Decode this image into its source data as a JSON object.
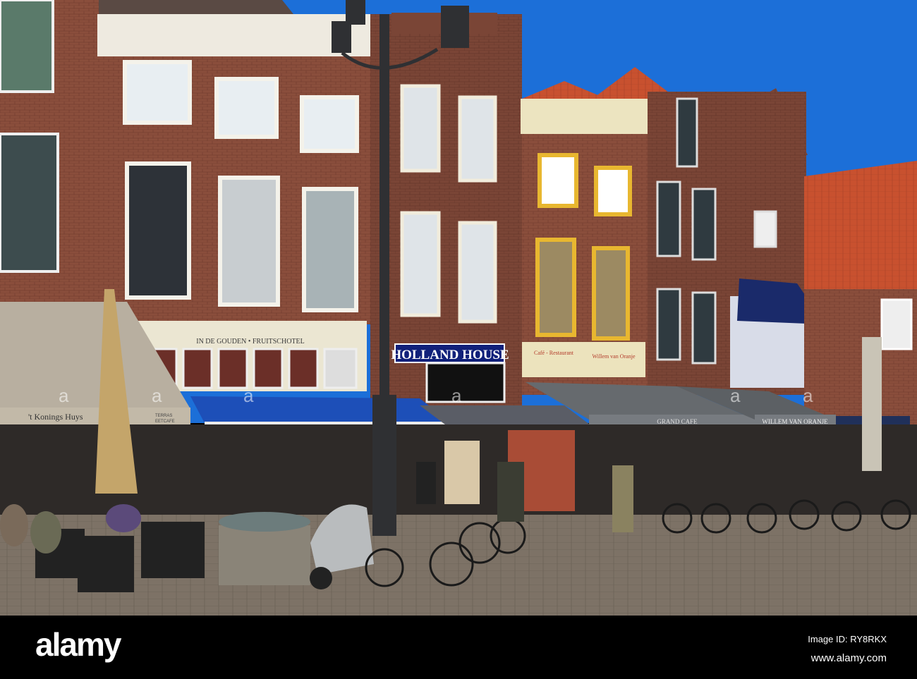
{
  "photo": {
    "signs": {
      "fruitschotel": "IN DE GOUDEN • FRUITSCHOTEL",
      "holland_house": "HOLLAND HOUSE",
      "cafe_restaurant": "Café - Restaurant",
      "willem_small": "Willem van Oranje",
      "grand_cafe": "GRAND CAFE",
      "willem_awning": "WILLEM VAN ORANJE",
      "konings_huys": "'t Konings Huys",
      "terras": "TERRAS",
      "eetcafe": "EETCAFE"
    },
    "colors": {
      "sky": "#1c6fd8",
      "brick": "#8a4e3c",
      "blue_awning": "#1d4fb8",
      "roof_tiles": "#c8512f",
      "pavement": "#7d7266"
    }
  },
  "watermark": {
    "logo": "alamy",
    "image_id": "Image ID: RY8RKX",
    "site": "www.alamy.com"
  }
}
